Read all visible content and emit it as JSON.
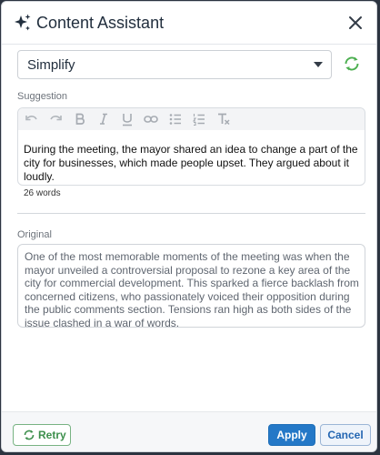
{
  "dialog": {
    "title": "Content Assistant",
    "icons": {
      "title": "sparkle-icon",
      "close": "close-icon"
    }
  },
  "mode_select": {
    "value": "Simplify",
    "icons": {
      "caret": "chevron-down-icon",
      "refresh": "refresh-icon"
    }
  },
  "suggestion": {
    "label": "Suggestion",
    "toolbar": [
      "undo-icon",
      "redo-icon",
      "bold-icon",
      "italic-icon",
      "underline-icon",
      "link-icon",
      "bulleted-list-icon",
      "numbered-list-icon",
      "clear-formatting-icon"
    ],
    "text": "During the meeting, the mayor shared an idea to change a part of the city for businesses, which made people upset. They argued about it loudly.",
    "word_count": "26 words"
  },
  "original": {
    "label": "Original",
    "text": "One of the most memorable moments of the meeting was when the mayor unveiled a controversial proposal to rezone a key area of the city for commercial development. This sparked a fierce backlash from concerned citizens, who passionately voiced their opposition during the public comments section. Tensions ran high as both sides of the issue clashed in a war of words."
  },
  "footer": {
    "retry_label": "Retry",
    "apply_label": "Apply",
    "cancel_label": "Cancel"
  },
  "colors": {
    "primary": "#2478c7",
    "retry_green": "#3d8f4c",
    "refresh_green": "#4caf50",
    "backdrop": "#2c3440"
  }
}
